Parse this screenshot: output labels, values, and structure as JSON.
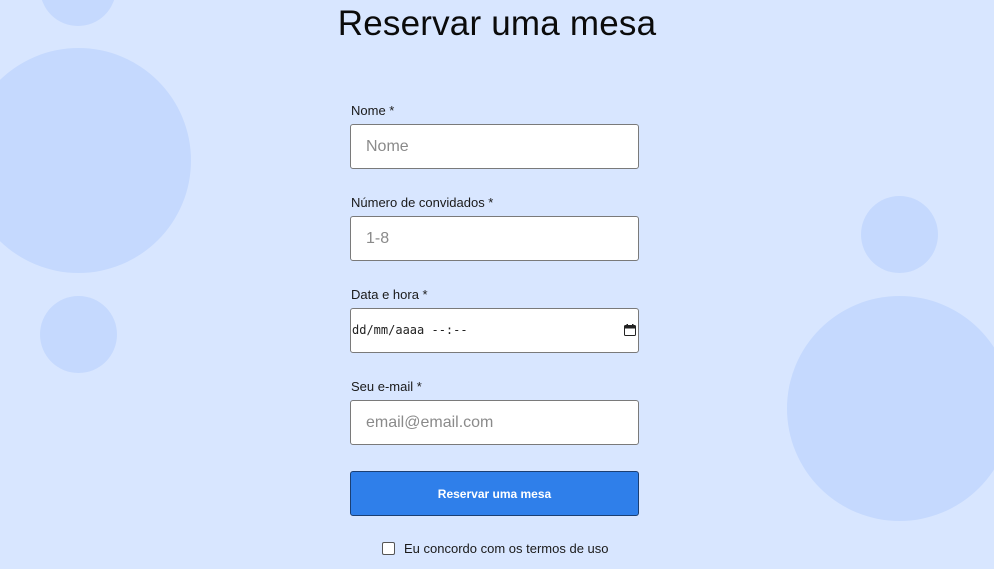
{
  "page": {
    "title": "Reservar uma mesa"
  },
  "form": {
    "name": {
      "label": "Nome *",
      "placeholder": "Nome",
      "value": ""
    },
    "guests": {
      "label": "Número de convidados *",
      "placeholder": "1-8",
      "value": ""
    },
    "datetime": {
      "label": "Data e hora *",
      "display": "dd/mm/aaaa --:--"
    },
    "email": {
      "label": "Seu e-mail *",
      "placeholder": "email@email.com",
      "value": ""
    },
    "submit_label": "Reservar uma mesa",
    "terms": {
      "label": "Eu concordo com os termos de uso",
      "checked": false
    }
  },
  "icons": {
    "calendar": "calendar-icon"
  },
  "colors": {
    "background": "#d8e6ff",
    "bubble": "#c5d9fe",
    "accent": "#2f7fea"
  }
}
